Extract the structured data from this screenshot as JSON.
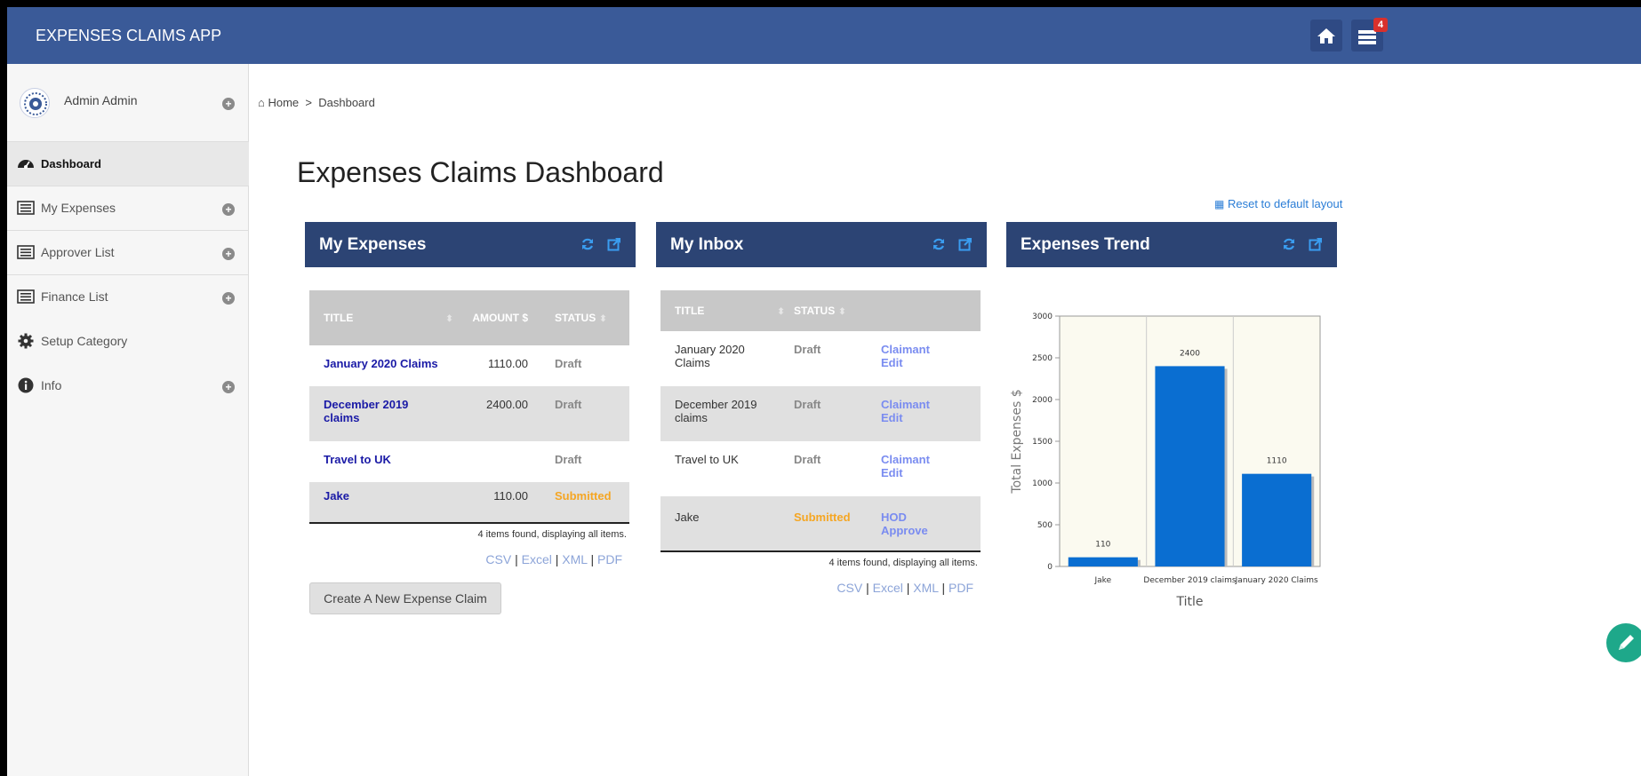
{
  "app": {
    "title": "EXPENSES CLAIMS APP",
    "badge_count": "4"
  },
  "user": {
    "name": "Admin Admin"
  },
  "sidebar": {
    "items": [
      {
        "label": "Dashboard",
        "icon": "dashboard-icon"
      },
      {
        "label": "My Expenses",
        "icon": "list-icon"
      },
      {
        "label": "Approver List",
        "icon": "list-icon"
      },
      {
        "label": "Finance List",
        "icon": "list-icon"
      },
      {
        "label": "Setup Category",
        "icon": "gear-icon"
      },
      {
        "label": "Info",
        "icon": "info-icon"
      }
    ]
  },
  "breadcrumb": {
    "home": "Home",
    "sep": ">",
    "current": "Dashboard"
  },
  "page": {
    "title": "Expenses Claims Dashboard",
    "reset_label": "Reset to default layout"
  },
  "my_expenses": {
    "title": "My Expenses",
    "columns": [
      "TITLE",
      "AMOUNT $",
      "STATUS"
    ],
    "rows": [
      {
        "title": "January 2020 Claims",
        "amount": "1110.00",
        "status": "Draft"
      },
      {
        "title": "December 2019 claims",
        "amount": "2400.00",
        "status": "Draft"
      },
      {
        "title": "Travel to UK",
        "amount": "",
        "status": "Draft"
      },
      {
        "title": "Jake",
        "amount": "110.00",
        "status": "Submitted"
      }
    ],
    "footer": "4 items found, displaying all items.",
    "exports": [
      "CSV",
      "Excel",
      "XML",
      "PDF"
    ],
    "create_label": "Create A New Expense Claim"
  },
  "my_inbox": {
    "title": "My Inbox",
    "columns": [
      "TITLE",
      "STATUS"
    ],
    "rows": [
      {
        "title": "January 2020 Claims",
        "status": "Draft",
        "action": "Claimant Edit"
      },
      {
        "title": "December 2019 claims",
        "status": "Draft",
        "action": "Claimant Edit"
      },
      {
        "title": "Travel to UK",
        "status": "Draft",
        "action": "Claimant Edit"
      },
      {
        "title": "Jake",
        "status": "Submitted",
        "action": "HOD Approve"
      }
    ],
    "footer": "4 items found, displaying all items.",
    "exports": [
      "CSV",
      "Excel",
      "XML",
      "PDF"
    ]
  },
  "trend": {
    "title": "Expenses Trend"
  },
  "colors": {
    "header": "#3a5a98",
    "panel": "#2c4474",
    "bar": "#0a6ed1",
    "submitted": "#f5a623",
    "link": "#1a1aa6"
  },
  "chart_data": {
    "type": "bar",
    "categories": [
      "Jake",
      "December 2019 claims",
      "January 2020 Claims"
    ],
    "values": [
      110,
      2400,
      1110
    ],
    "xlabel": "Title",
    "ylabel": "Total Expenses $",
    "ylim": [
      0,
      3000
    ],
    "yticks": [
      0,
      500,
      1000,
      1500,
      2000,
      2500,
      3000
    ],
    "grid": true,
    "legend": "none"
  }
}
